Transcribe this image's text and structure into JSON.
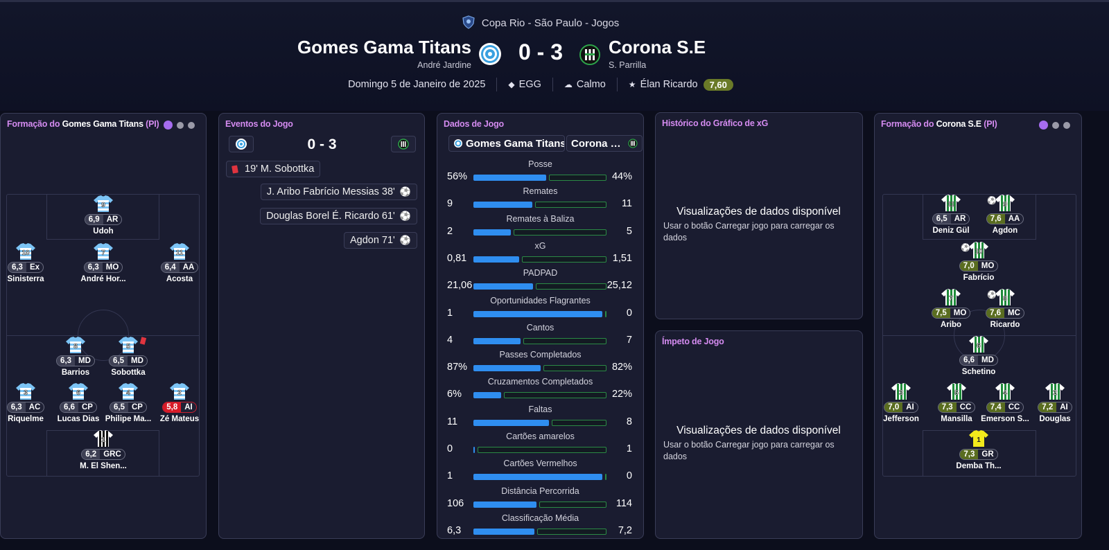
{
  "header": {
    "competition": "Copa Rio - São Paulo - Jogos",
    "home": {
      "name": "Gomes Gama Titans",
      "coach": "André Jardine"
    },
    "away": {
      "name": "Corona S.E",
      "coach": "S. Parrilla"
    },
    "score": "0 - 3",
    "date": "Domingo 5 de Janeiro de 2025",
    "stadium": "EGG",
    "weather": "Calmo",
    "motm": "Élan Ricardo",
    "motm_rating": "7,60"
  },
  "home_formation": {
    "title_prefix": "Formação do",
    "team": "Gomes Gama Titans",
    "suffix": "(PI)",
    "players": [
      {
        "name": "Udoh",
        "num": "9",
        "rating": "6,9",
        "pos": "AR",
        "col": 1,
        "row": 0
      },
      {
        "name": "Sinisterra",
        "num": "10",
        "rating": "6,3",
        "pos": "Ex",
        "col": 0,
        "row": 1
      },
      {
        "name": "André Hor...",
        "num": "7",
        "rating": "6,3",
        "pos": "MO",
        "col": 1,
        "row": 1
      },
      {
        "name": "Acosta",
        "num": "11",
        "rating": "6,4",
        "pos": "AA",
        "col": 2,
        "row": 1
      },
      {
        "name": "Barrios",
        "num": "8",
        "rating": "6,3",
        "pos": "MD",
        "col": 3,
        "row": 2
      },
      {
        "name": "Sobottka",
        "num": "5",
        "rating": "6,5",
        "pos": "MD",
        "col": 4,
        "row": 2,
        "red": true
      },
      {
        "name": "Riquelme",
        "num": "3",
        "rating": "6,3",
        "pos": "AC",
        "col": 0,
        "row": 3
      },
      {
        "name": "Lucas Dias",
        "num": "6",
        "rating": "6,6",
        "pos": "CP",
        "col": 5,
        "row": 3
      },
      {
        "name": "Philipe Ma...",
        "num": "4",
        "rating": "6,5",
        "pos": "CP",
        "col": 6,
        "row": 3
      },
      {
        "name": "Zé Mateus",
        "num": "2",
        "rating": "5,8",
        "pos": "AI",
        "col": 2,
        "row": 3,
        "bad": true
      },
      {
        "name": "M. El Shen...",
        "num": "1",
        "rating": "6,2",
        "pos": "GRC",
        "col": 1,
        "row": 4,
        "gk": true
      }
    ]
  },
  "events": {
    "title": "Eventos do Jogo",
    "score": "0 - 3",
    "items": [
      {
        "side": "home",
        "text": "19' M. Sobottka",
        "type": "red"
      },
      {
        "side": "away",
        "text": "J. Aribo Fabrício Messias 38'",
        "type": "goal"
      },
      {
        "side": "away",
        "text": "Douglas Borel É. Ricardo 61'",
        "type": "goal"
      },
      {
        "side": "away",
        "text": "Agdon 71'",
        "type": "goal"
      }
    ]
  },
  "stats": {
    "title": "Dados de Jogo",
    "home_team": "Gomes Gama Titans",
    "away_team": "Corona S.E",
    "rows": [
      {
        "label": "Posse",
        "home": "56%",
        "away": "44%",
        "h": 56,
        "a": 44
      },
      {
        "label": "Remates",
        "home": "9",
        "away": "11",
        "h": 9,
        "a": 11
      },
      {
        "label": "Remates à Baliza",
        "home": "2",
        "away": "5",
        "h": 2,
        "a": 5
      },
      {
        "label": "xG",
        "home": "0,81",
        "away": "1,51",
        "h": 0.81,
        "a": 1.51
      },
      {
        "label": "PADPAD",
        "home": "21,06",
        "away": "25,12",
        "h": 21.06,
        "a": 25.12
      },
      {
        "label": "Oportunidades Flagrantes",
        "home": "1",
        "away": "0",
        "h": 1,
        "a": 0
      },
      {
        "label": "Cantos",
        "home": "4",
        "away": "7",
        "h": 4,
        "a": 7
      },
      {
        "label": "Passes Completados",
        "home": "87%",
        "away": "82%",
        "h": 87,
        "a": 82
      },
      {
        "label": "Cruzamentos Completados",
        "home": "6%",
        "away": "22%",
        "h": 6,
        "a": 22
      },
      {
        "label": "Faltas",
        "home": "11",
        "away": "8",
        "h": 11,
        "a": 8
      },
      {
        "label": "Cartões amarelos",
        "home": "0",
        "away": "1",
        "h": 0,
        "a": 1
      },
      {
        "label": "Cartões Vermelhos",
        "home": "1",
        "away": "0",
        "h": 1,
        "a": 0
      },
      {
        "label": "Distância Percorrida",
        "home": "106",
        "away": "114",
        "h": 106,
        "a": 114
      },
      {
        "label": "Classificação Média",
        "home": "6,3",
        "away": "7,2",
        "h": 6.3,
        "a": 7.2
      }
    ]
  },
  "xg_panel": {
    "title": "Histórico do Gráfico de xG",
    "message": "Visualizações de dados disponível",
    "sub": "Usar o botão Carregar jogo para carregar os dados"
  },
  "momentum_panel": {
    "title": "Ímpeto de Jogo",
    "message": "Visualizações de dados disponível",
    "sub": "Usar o botão Carregar jogo para carregar os dados"
  },
  "away_formation": {
    "title_prefix": "Formação do",
    "team": "Corona S.E",
    "suffix": "(PI)",
    "players": [
      {
        "name": "Deniz Gül",
        "num": "11",
        "rating": "6,5",
        "pos": "AR"
      },
      {
        "name": "Agdon",
        "num": "9",
        "rating": "7,6",
        "pos": "AA",
        "good": true,
        "goal": true
      },
      {
        "name": "Fabrício",
        "num": "10",
        "rating": "7,0",
        "pos": "MO",
        "good": true,
        "goal": true
      },
      {
        "name": "Aribo",
        "num": "7",
        "rating": "7,5",
        "pos": "MO",
        "good": true
      },
      {
        "name": "Ricardo",
        "num": "8",
        "rating": "7,6",
        "pos": "MC",
        "good": true,
        "goal": true
      },
      {
        "name": "Schetino",
        "num": "6",
        "rating": "6,6",
        "pos": "MD"
      },
      {
        "name": "Jefferson",
        "num": "3",
        "rating": "7,0",
        "pos": "AI",
        "good": true
      },
      {
        "name": "Mansilla",
        "num": "5",
        "rating": "7,3",
        "pos": "CC",
        "good": true
      },
      {
        "name": "Emerson S...",
        "num": "4",
        "rating": "7,4",
        "pos": "CC",
        "good": true
      },
      {
        "name": "Douglas",
        "num": "2",
        "rating": "7,2",
        "pos": "AI",
        "good": true
      },
      {
        "name": "Demba Th...",
        "num": "1",
        "rating": "7,3",
        "pos": "GR",
        "good": true,
        "gk": true
      }
    ]
  },
  "colors": {
    "accent": "#d48bf0",
    "home_bar": "#2f8ef0",
    "away_bar": "#2b8a45",
    "good_rating": "#5a6d20",
    "bad_rating": "#d81b28"
  },
  "icons": {
    "stadium": "diamond-icon",
    "weather": "cloud-icon",
    "motm": "star-icon",
    "goal": "football-icon",
    "red_card": "red-card-icon"
  }
}
